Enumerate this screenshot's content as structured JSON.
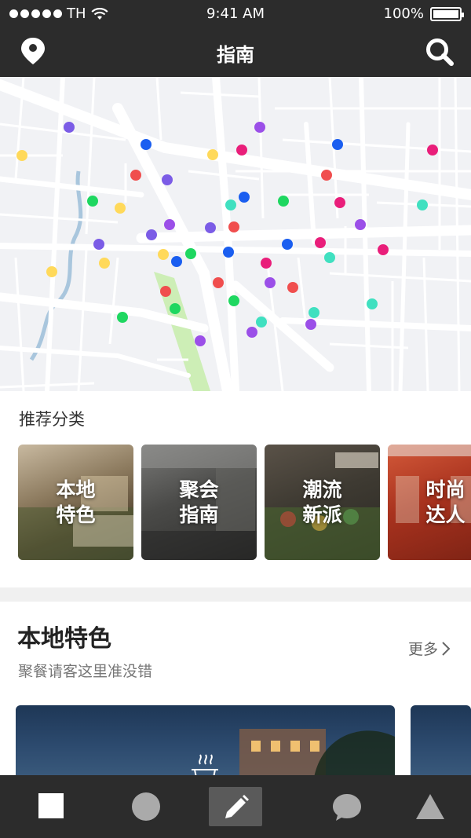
{
  "status_bar": {
    "carrier": "TH",
    "time": "9:41 AM",
    "battery": "100%"
  },
  "header": {
    "title": "指南",
    "left_icon": "location-pin-icon",
    "right_icon": "search-icon"
  },
  "map": {
    "marker_colors": [
      "#7b5ce6",
      "#1a5ef0",
      "#f04e4e",
      "#e91e7a",
      "#1ed760",
      "#ffd95a",
      "#40e0c0",
      "#9b4fe8"
    ]
  },
  "categories": {
    "label": "推荐分类",
    "items": [
      {
        "line1": "本地",
        "line2": "特色"
      },
      {
        "line1": "聚会",
        "line2": "指南"
      },
      {
        "line1": "潮流",
        "line2": "新派"
      },
      {
        "line1": "时尚",
        "line2": "达人"
      }
    ]
  },
  "feature": {
    "title": "本地特色",
    "subtitle": "聚餐请客这里准没错",
    "more_label": "更多"
  },
  "tabbar": {
    "items": [
      "square-icon",
      "circle-icon",
      "pencil-icon",
      "chat-bubble-icon",
      "triangle-icon"
    ],
    "active_index": 2
  },
  "colors": {
    "header_bg": "#2c2c2c",
    "tabbar_bg": "#2c2c2c",
    "active_tab_bg": "#5a5a5a"
  }
}
